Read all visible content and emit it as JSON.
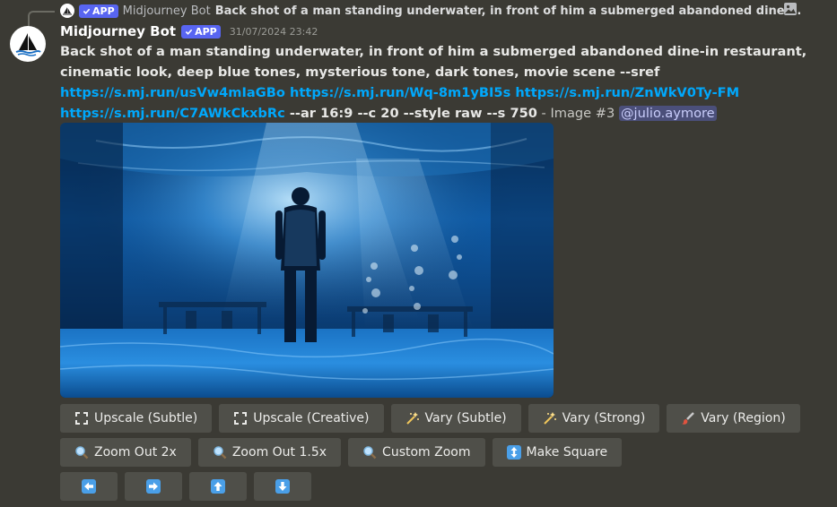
{
  "reply": {
    "bot_name": "Midjourney Bot",
    "badge": "APP",
    "text": "Back shot of a man standing underwater, in front of him a submerged abandoned dine-in restaurant, cinematic look, deep blue tones, mysterious tone, dark tones, movie scene --sref https://s.mj.run/usVw4mIaGBo"
  },
  "message": {
    "username": "Midjourney Bot",
    "badge": "APP",
    "timestamp": "31/07/2024 23:42",
    "prompt_text": "Back shot of a man standing underwater, in front of him a submerged abandoned dine-in restaurant, cinematic look, deep blue tones, mysterious tone, dark tones, movie scene --sref ",
    "links": [
      "https://s.mj.run/usVw4mIaGBo",
      "https://s.mj.run/Wq-8m1yBI5s",
      "https://s.mj.run/ZnWkV0Ty-FM",
      "https://s.mj.run/C7AWkCkxbRc"
    ],
    "params": "--ar 16:9 --c 20 --style raw --s 750",
    "image_label": " - Image #3 ",
    "mention": "@julio.aymore"
  },
  "buttons": {
    "row1": [
      "Upscale (Subtle)",
      "Upscale (Creative)",
      "Vary (Subtle)",
      "Vary (Strong)",
      "Vary (Region)"
    ],
    "row2": [
      "Zoom Out 2x",
      "Zoom Out 1.5x",
      "Custom Zoom",
      "Make Square"
    ],
    "row3_icons": [
      "arrow-left-icon",
      "arrow-right-icon",
      "arrow-up-icon",
      "arrow-down-icon"
    ]
  },
  "colors": {
    "background": "#3b3a34",
    "link": "#00a8fc",
    "badge": "#5865f2",
    "button": "#4f4f49"
  }
}
